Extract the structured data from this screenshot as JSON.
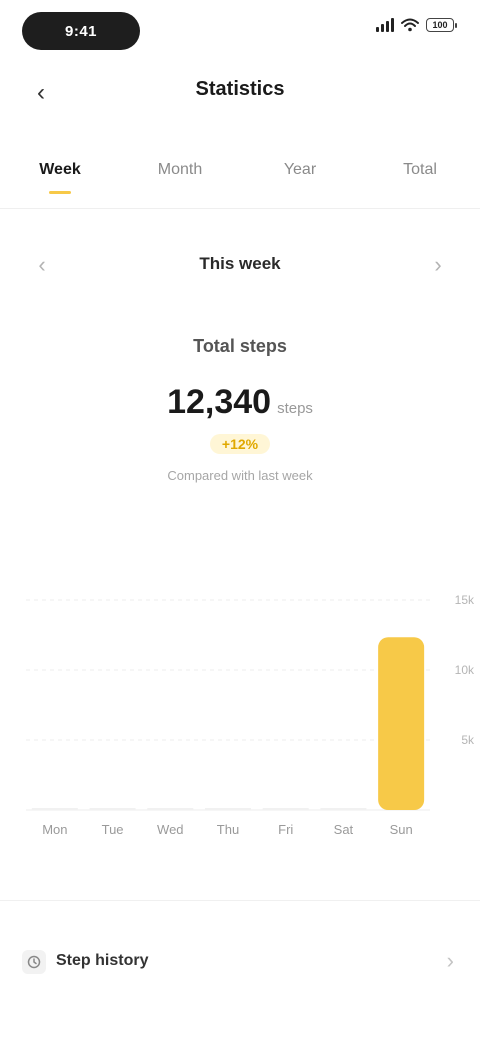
{
  "status_bar": {
    "time": "9:41",
    "battery": "100"
  },
  "header": {
    "back_icon": "chevron-left-icon",
    "title": "Statistics"
  },
  "tabs": [
    {
      "label": "Week",
      "active": true
    },
    {
      "label": "Month",
      "active": false
    },
    {
      "label": "Year",
      "active": false
    },
    {
      "label": "Total",
      "active": false
    }
  ],
  "date_nav": {
    "prev_icon": "chevron-left-icon",
    "label": "This week",
    "next_icon": "chevron-right-icon"
  },
  "summary": {
    "label": "Total steps",
    "value": "12,340",
    "unit": "steps",
    "change": "+12%",
    "note": "Compared with last week"
  },
  "chart_data": {
    "type": "bar",
    "categories": [
      "Mon",
      "Tue",
      "Wed",
      "Thu",
      "Fri",
      "Sat",
      "Sun"
    ],
    "values": [
      0,
      0,
      0,
      0,
      0,
      0,
      12340
    ],
    "ylim": [
      0,
      15000
    ],
    "yticks": [
      "15k",
      "10k",
      "5k"
    ],
    "highlight_color": "#f7c948",
    "grid": true
  },
  "list": {
    "row_label": "Step history",
    "row_icon": "history-icon",
    "chevron_icon": "chevron-right-icon"
  },
  "colors": {
    "accent": "#f7c948"
  }
}
